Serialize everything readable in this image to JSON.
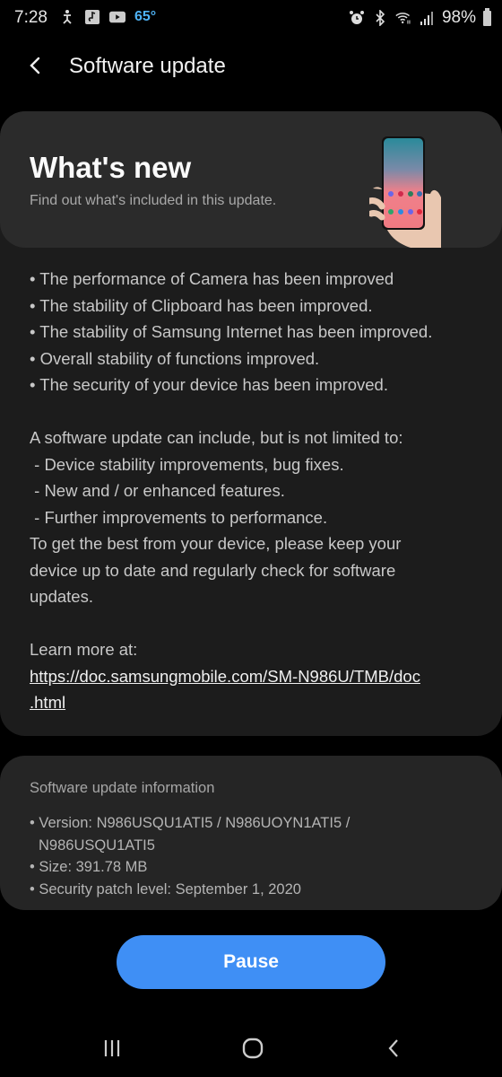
{
  "status_bar": {
    "time": "7:28",
    "temperature": "65°",
    "battery": "98%",
    "left_icons": [
      "accessibility-icon",
      "music-app-icon",
      "youtube-icon"
    ],
    "right_icons": [
      "alarm-icon",
      "bluetooth-icon",
      "wifi-icon",
      "signal-icon",
      "battery-icon"
    ]
  },
  "header": {
    "title": "Software update",
    "back_icon": "back-arrow-icon"
  },
  "whats_new": {
    "title": "What's new",
    "subtitle": "Find out what's included in this update.",
    "image": "phone-in-hand-illustration"
  },
  "release_notes": {
    "bullets": [
      "• The performance of Camera has been improved",
      "• The stability of Clipboard has been improved.",
      "• The stability of Samsung Internet has been improved.",
      "• Overall stability of functions improved.",
      "• The security of your device has been improved."
    ],
    "intro": "A software update can include, but is not limited to:",
    "includes": [
      " - Device stability improvements, bug fixes.",
      " - New and / or enhanced features.",
      " - Further improvements to performance."
    ],
    "advice_lines": [
      "To get the best from your device, please keep your",
      "device up to date and regularly check for software",
      "updates."
    ],
    "learn_more": "Learn more at:",
    "link_line1": "https://doc.samsungmobile.com/SM-N986U/TMB/doc",
    "link_line2": ".html"
  },
  "update_info": {
    "heading": "Software update information",
    "version_label": "• Version: N986USQU1ATI5 / N986UOYN1ATI5 /",
    "version_cont": "N986USQU1ATI5",
    "size": "• Size: 391.78 MB",
    "security_patch": "• Security patch level: September 1, 2020"
  },
  "actions": {
    "pause_label": "Pause"
  },
  "nav_bar": {
    "recents": "recents-icon",
    "home": "home-icon",
    "back": "back-icon"
  },
  "colors": {
    "accent": "#3f8ff5",
    "temperature": "#4fb3f5",
    "card": "#1c1c1c",
    "hero": "#2b2b2b"
  }
}
